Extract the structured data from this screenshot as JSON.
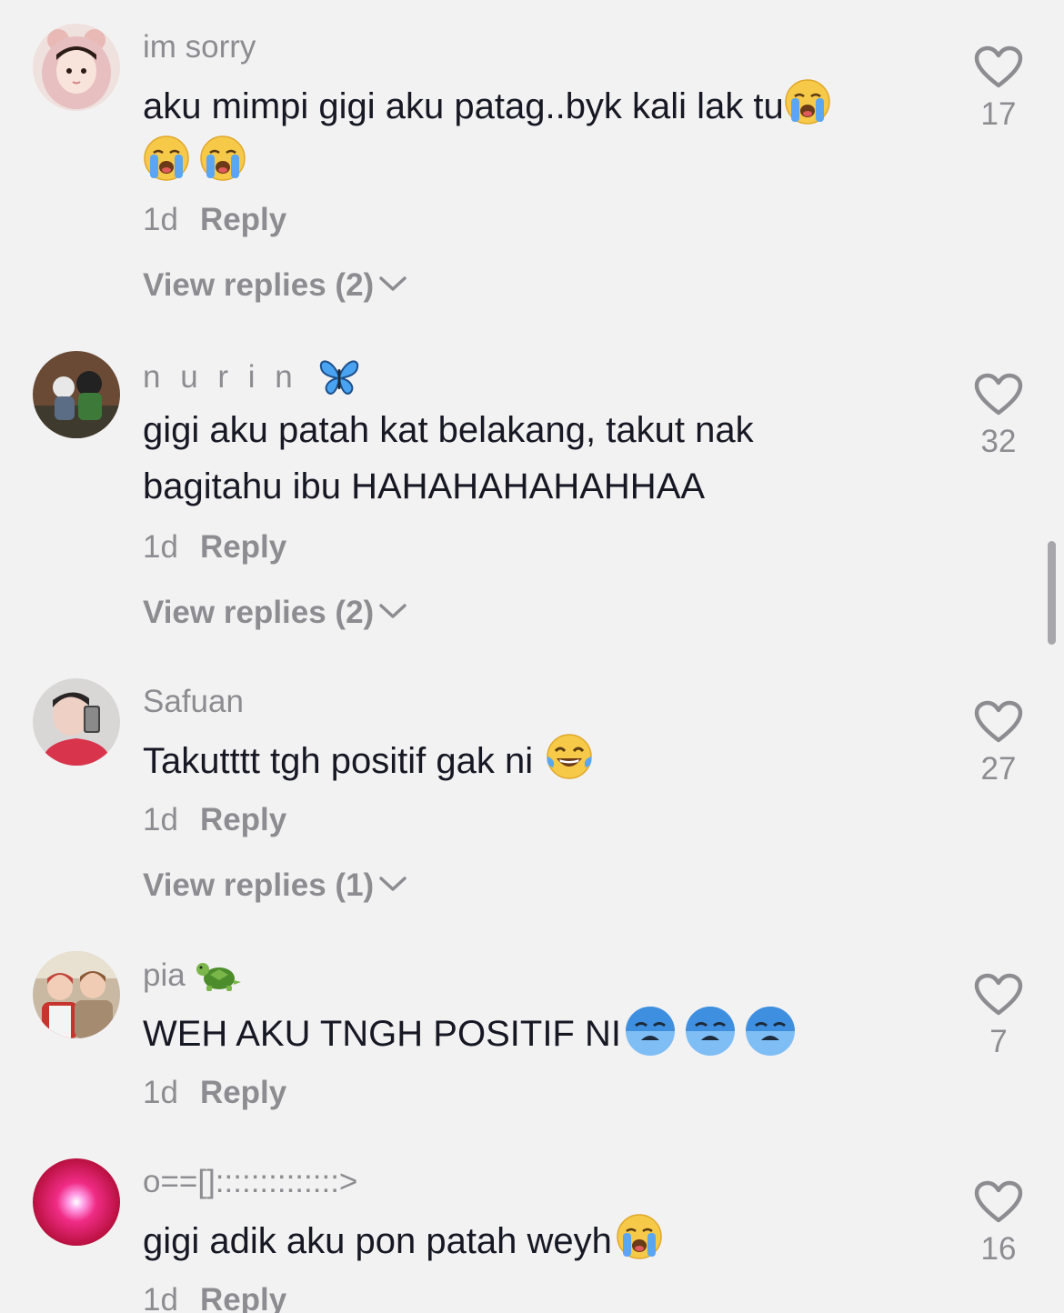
{
  "comments": [
    {
      "username": "im sorry",
      "text_lines": [
        "aku mimpi gigi aku patag..byk kali lak tu",
        ""
      ],
      "time": "1d",
      "reply_label": "Reply",
      "view_replies": "View replies (2)",
      "likes": "17",
      "avatar_icon": "girl-avatar",
      "emoji": "loudly-crying-face"
    },
    {
      "username": "n u r i n",
      "text_lines": [
        "gigi aku patah kat belakang, takut nak",
        "bagitahu ibu HAHAHAHAHAHHAA"
      ],
      "time": "1d",
      "reply_label": "Reply",
      "view_replies": "View replies (2)",
      "likes": "32",
      "avatar_icon": "anime-avatar",
      "emoji": "butterfly"
    },
    {
      "username": "Safuan",
      "text_lines": [
        "Takutttt tgh positif gak ni"
      ],
      "time": "1d",
      "reply_label": "Reply",
      "view_replies": "View replies (1)",
      "likes": "27",
      "avatar_icon": "boy-selfie-avatar",
      "emoji": "tears-of-joy-face"
    },
    {
      "username": "pia",
      "text_lines": [
        "WEH AKU TNGH POSITIF NI"
      ],
      "time": "1d",
      "reply_label": "Reply",
      "likes": "7",
      "avatar_icon": "two-people-avatar",
      "emoji": "turtle"
    },
    {
      "username": "o==[]::::::::::::::>",
      "text_lines": [
        "gigi adik aku pon patah weyh"
      ],
      "time": "1d",
      "reply_label": "Reply",
      "likes": "16",
      "avatar_icon": "pink-light-avatar",
      "emoji": "loudly-crying-face"
    }
  ],
  "colors": {
    "background": "#f3f2f3",
    "text": "#161823",
    "secondary": "#8d8c91"
  }
}
